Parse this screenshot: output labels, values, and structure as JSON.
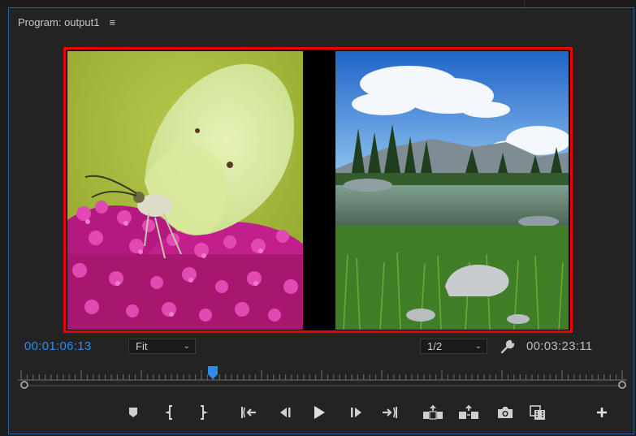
{
  "panel": {
    "title": "Program: output1",
    "menu_glyph": "≡"
  },
  "monitor": {
    "left_clip": "butterfly-on-pink-flowers",
    "right_clip": "mountain-lake-landscape",
    "border_color": "#ee0000"
  },
  "toolbar": {
    "current_time": "00:01:06:13",
    "zoom": "Fit",
    "resolution": "1/2",
    "duration": "00:03:23:11"
  },
  "timeline": {
    "playhead_fraction": 0.33
  },
  "transport": [
    {
      "name": "add-marker-icon"
    },
    {
      "name": "mark-in-icon"
    },
    {
      "name": "mark-out-icon"
    },
    {
      "name": "go-to-in-icon"
    },
    {
      "name": "step-back-icon"
    },
    {
      "name": "play-icon"
    },
    {
      "name": "step-forward-icon"
    },
    {
      "name": "go-to-out-icon"
    },
    {
      "name": "lift-icon"
    },
    {
      "name": "extract-icon"
    },
    {
      "name": "export-frame-icon"
    },
    {
      "name": "comparison-view-icon"
    },
    {
      "name": "add-button-icon"
    }
  ],
  "colors": {
    "accent": "#2d8ceb",
    "panel_border": "#2d5f9a",
    "background": "#232323"
  }
}
